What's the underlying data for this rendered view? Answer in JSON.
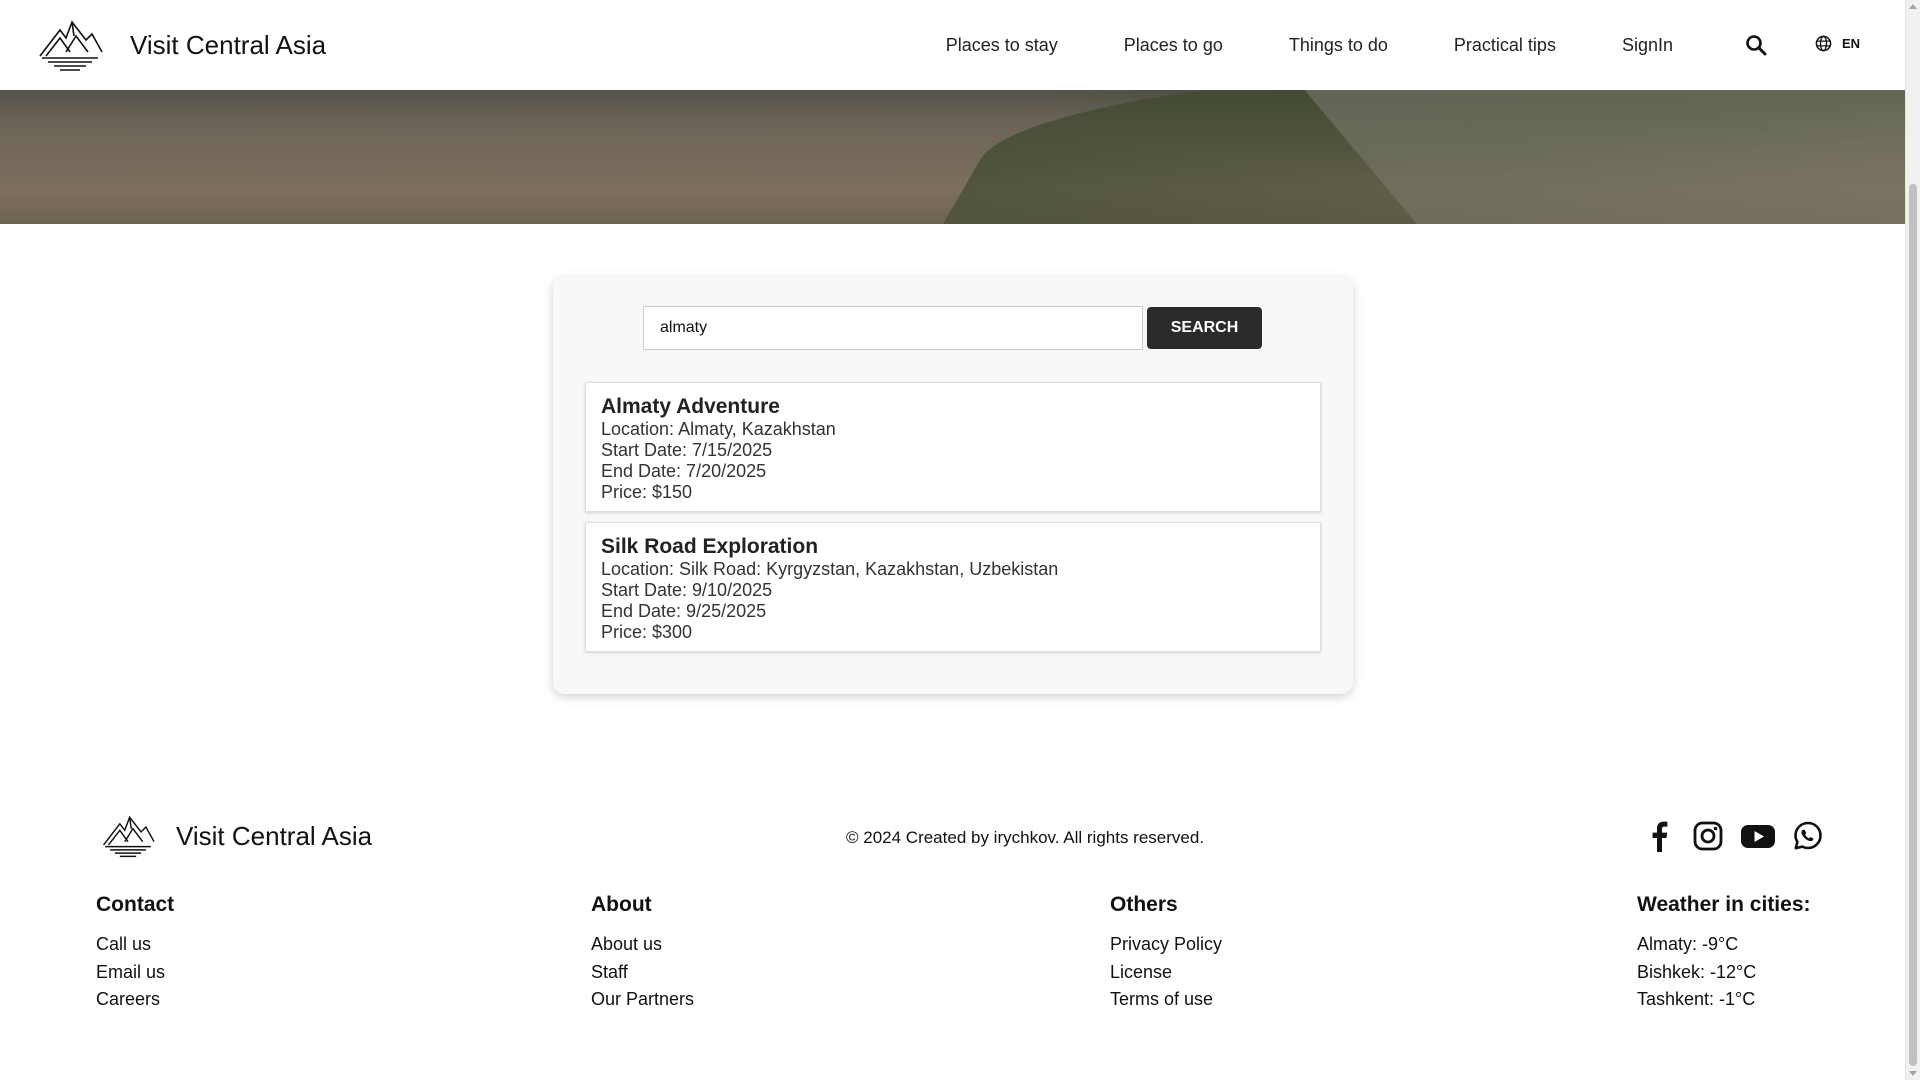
{
  "brand": {
    "name": "Visit Central Asia"
  },
  "nav": {
    "items": [
      {
        "label": "Places to stay"
      },
      {
        "label": "Places to go"
      },
      {
        "label": "Things to do"
      },
      {
        "label": "Practical tips"
      },
      {
        "label": "SignIn"
      }
    ],
    "search_icon": "search-icon",
    "language": "EN"
  },
  "search": {
    "value": "almaty",
    "button_label": "SEARCH"
  },
  "results": [
    {
      "title": "Almaty Adventure",
      "location": "Location: Almaty, Kazakhstan",
      "start": "Start Date: 7/15/2025",
      "end": "End Date: 7/20/2025",
      "price": "Price: $150"
    },
    {
      "title": "Silk Road Exploration",
      "location": "Location: Silk Road: Kyrgyzstan, Kazakhstan, Uzbekistan",
      "start": "Start Date: 9/10/2025",
      "end": "End Date: 9/25/2025",
      "price": "Price: $300"
    }
  ],
  "footer": {
    "brand_name": "Visit Central Asia",
    "copyright": "© 2024 Created by irychkov. All rights reserved.",
    "socials": [
      "facebook-icon",
      "instagram-icon",
      "youtube-icon",
      "whatsapp-icon"
    ],
    "columns": [
      {
        "heading": "Contact",
        "links": [
          "Call us",
          "Email us",
          "Careers"
        ]
      },
      {
        "heading": "About",
        "links": [
          "About us",
          "Staff",
          "Our Partners"
        ]
      },
      {
        "heading": "Others",
        "links": [
          "Privacy Policy",
          "License",
          "Terms of use"
        ]
      },
      {
        "heading": "Weather in cities:",
        "links": [
          "Almaty: -9°C",
          "Bishkek: -12°C",
          "Tashkent: -1°C"
        ]
      }
    ]
  },
  "colors": {
    "button_bg": "#2b2b2b",
    "card_bg": "#f8f8f8",
    "text": "#111111"
  }
}
